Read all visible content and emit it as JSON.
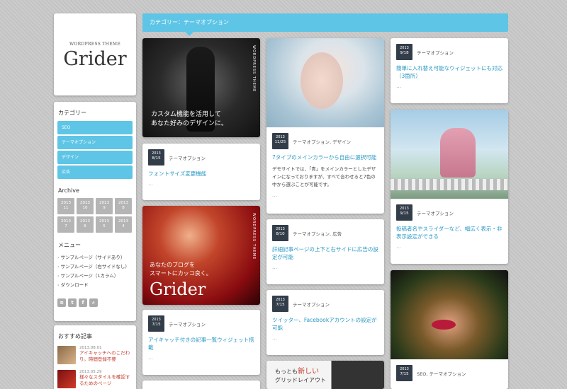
{
  "logo": {
    "sub": "WORDPRESS THEME",
    "main": "Grider"
  },
  "sidebar": {
    "cat_title": "カテゴリー",
    "categories": [
      "SEO",
      "テーマオプション",
      "デザイン",
      "広告"
    ],
    "archive_title": "Archive",
    "archive": [
      {
        "y": "2013",
        "m": "11"
      },
      {
        "y": "2013",
        "m": "10"
      },
      {
        "y": "2013",
        "m": "9"
      },
      {
        "y": "2013",
        "m": "8"
      },
      {
        "y": "2013",
        "m": "7"
      },
      {
        "y": "2013",
        "m": "6"
      },
      {
        "y": "2013",
        "m": "5"
      },
      {
        "y": "2013",
        "m": "4"
      }
    ],
    "menu_title": "メニュー",
    "menu": [
      "サンプルページ（サイドあり）",
      "サンプルページ（右サイドなし）",
      "サンプルページ（1カラム）",
      "ダウンロード"
    ],
    "social": [
      "rss-icon",
      "twitter-icon",
      "facebook-icon",
      "search-icon"
    ]
  },
  "recommend": {
    "title": "おすすめ記事",
    "items": [
      {
        "date": "2013.08.01",
        "text": "アイキャッチへのこだわり。時間登録不要"
      },
      {
        "date": "2013.05.29",
        "text": "様々なスタイルを確認するためのページ"
      }
    ]
  },
  "header": {
    "title": "カテゴリー：テーマオプション"
  },
  "posts": {
    "p1_img": {
      "text1": "カスタム機能を活用して",
      "text2": "あなた好みのデザインに。",
      "vertical": "WORDPRESS THEME"
    },
    "p1": {
      "year": "2013",
      "date": "8/15",
      "cats": "テーマオプション",
      "title": "フォントサイズ変更機能",
      "more": "…"
    },
    "p2_img": {
      "text1": "あなたのブログを",
      "text2": "スマートにカッコ良く。",
      "big": "Grider",
      "vertical": "WORDPRESS THEME"
    },
    "p2": {
      "year": "2013",
      "date": "7/15",
      "cats": "テーマオプション",
      "title": "アイキャッチ付きの記事一覧ウィジェット搭載",
      "more": "…"
    },
    "p3": {
      "year": "2013",
      "date": "11/25",
      "cats": "テーマオプション, デザイン",
      "title": "7タイプのメインカラーから自由に選択可能",
      "excerpt": "デモサイトでは、「青」をメインカラーとしたデザインになっておりますが、すべて合わせると7色の中から選ぶことが可能です。",
      "more": "…"
    },
    "p4": {
      "year": "2013",
      "date": "8/10",
      "cats": "テーマオプション, 広告",
      "title": "詳細記事ページの上下と右サイドに広告の設定が可能",
      "more": "…"
    },
    "p5": {
      "year": "2013",
      "date": "7/15",
      "cats": "テーマオプション",
      "title": "ツイッター、Facebookアカウントの設定が可能",
      "more": "…"
    },
    "p6_img": {
      "text1": "もっとも",
      "accent": "新しい",
      "text2": "グリッドレイアウト"
    },
    "p7": {
      "year": "2013",
      "date": "9/18",
      "cats": "テーマオプション",
      "title": "簡単に入れ替え可能なウィジェットにも対応（3箇所）",
      "more": "…"
    },
    "p8": {
      "year": "2013",
      "date": "9/15",
      "cats": "テーマオプション",
      "title": "投稿者名やスライダーなど、幅広く表示・非表示設定ができる",
      "more": "…"
    },
    "p9": {
      "year": "2013",
      "date": "7/15",
      "cats": "SEO, テーマオプション"
    }
  }
}
